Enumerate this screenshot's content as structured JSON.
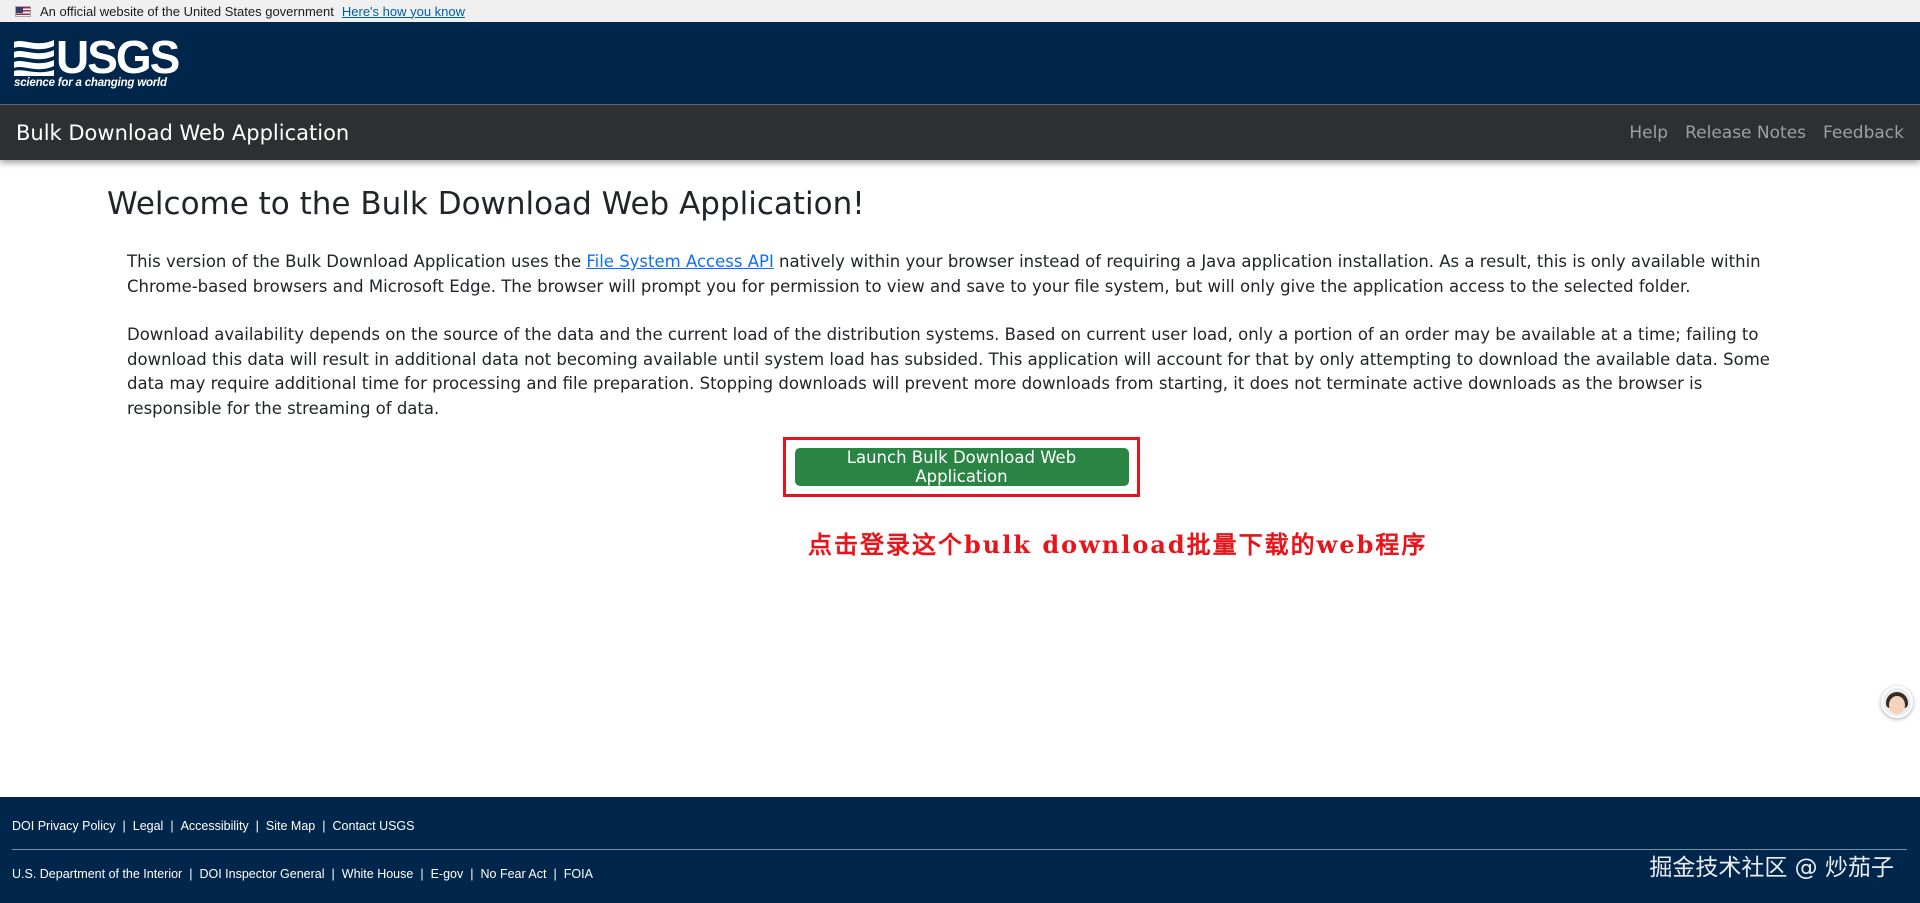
{
  "gov_banner": {
    "text": "An official website of the United States government",
    "link": "Here's how you know"
  },
  "header": {
    "logo_text": "USGS",
    "tagline": "science for a changing world"
  },
  "navbar": {
    "title": "Bulk Download Web Application",
    "links": [
      "Help",
      "Release Notes",
      "Feedback"
    ]
  },
  "main": {
    "heading": "Welcome to the Bulk Download Web Application!",
    "p1_before": "This version of the Bulk Download Application uses the ",
    "p1_link": "File System Access API",
    "p1_after": " natively within your browser instead of requiring a Java application installation. As a result, this is only available within Chrome-based browsers and Microsoft Edge. The browser will prompt you for permission to view and save to your file system, but will only give the application access to the selected folder.",
    "p2": "Download availability depends on the source of the data and the current load of the distribution systems. Based on current user load, only a portion of an order may be available at a time; failing to download this data will result in additional data not becoming available until system load has subsided. This application will account for that by only attempting to download the available data. Some data may require additional time for processing and file preparation. Stopping downloads will prevent more downloads from starting, it does not terminate active downloads as the browser is responsible for the streaming of data.",
    "launch_button": "Launch Bulk Download Web Application",
    "annotation": "点击登录这个bulk download批量下载的web程序"
  },
  "footer": {
    "row1": [
      "DOI Privacy Policy",
      "Legal",
      "Accessibility",
      "Site Map",
      "Contact USGS"
    ],
    "row2": [
      "U.S. Department of the Interior",
      "DOI Inspector General",
      "White House",
      "E-gov",
      "No Fear Act",
      "FOIA"
    ],
    "watermark": "掘金技术社区 @ 炒茄子"
  },
  "colors": {
    "header_bg": "#00264c",
    "navbar_bg": "#2d2f30",
    "button_green": "#2a8444",
    "annotation_red": "#e8141a"
  }
}
